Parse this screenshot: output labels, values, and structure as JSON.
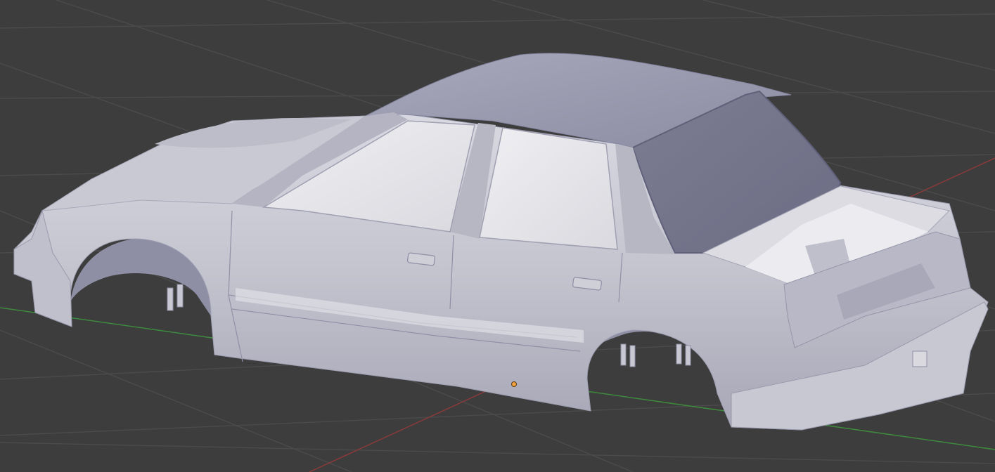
{
  "viewport": {
    "background": "#3d3d3d",
    "grid_color": "#4b4b4b",
    "x_axis_color": "#8a3a3a",
    "y_axis_color": "#3e8a3e",
    "object_origin_color": "#f0a040",
    "mesh_color": "#c8c8d2",
    "mesh_shadow_color": "#9a9aae",
    "glass_color": "#e6e6ea",
    "object": "car-body-mesh"
  }
}
